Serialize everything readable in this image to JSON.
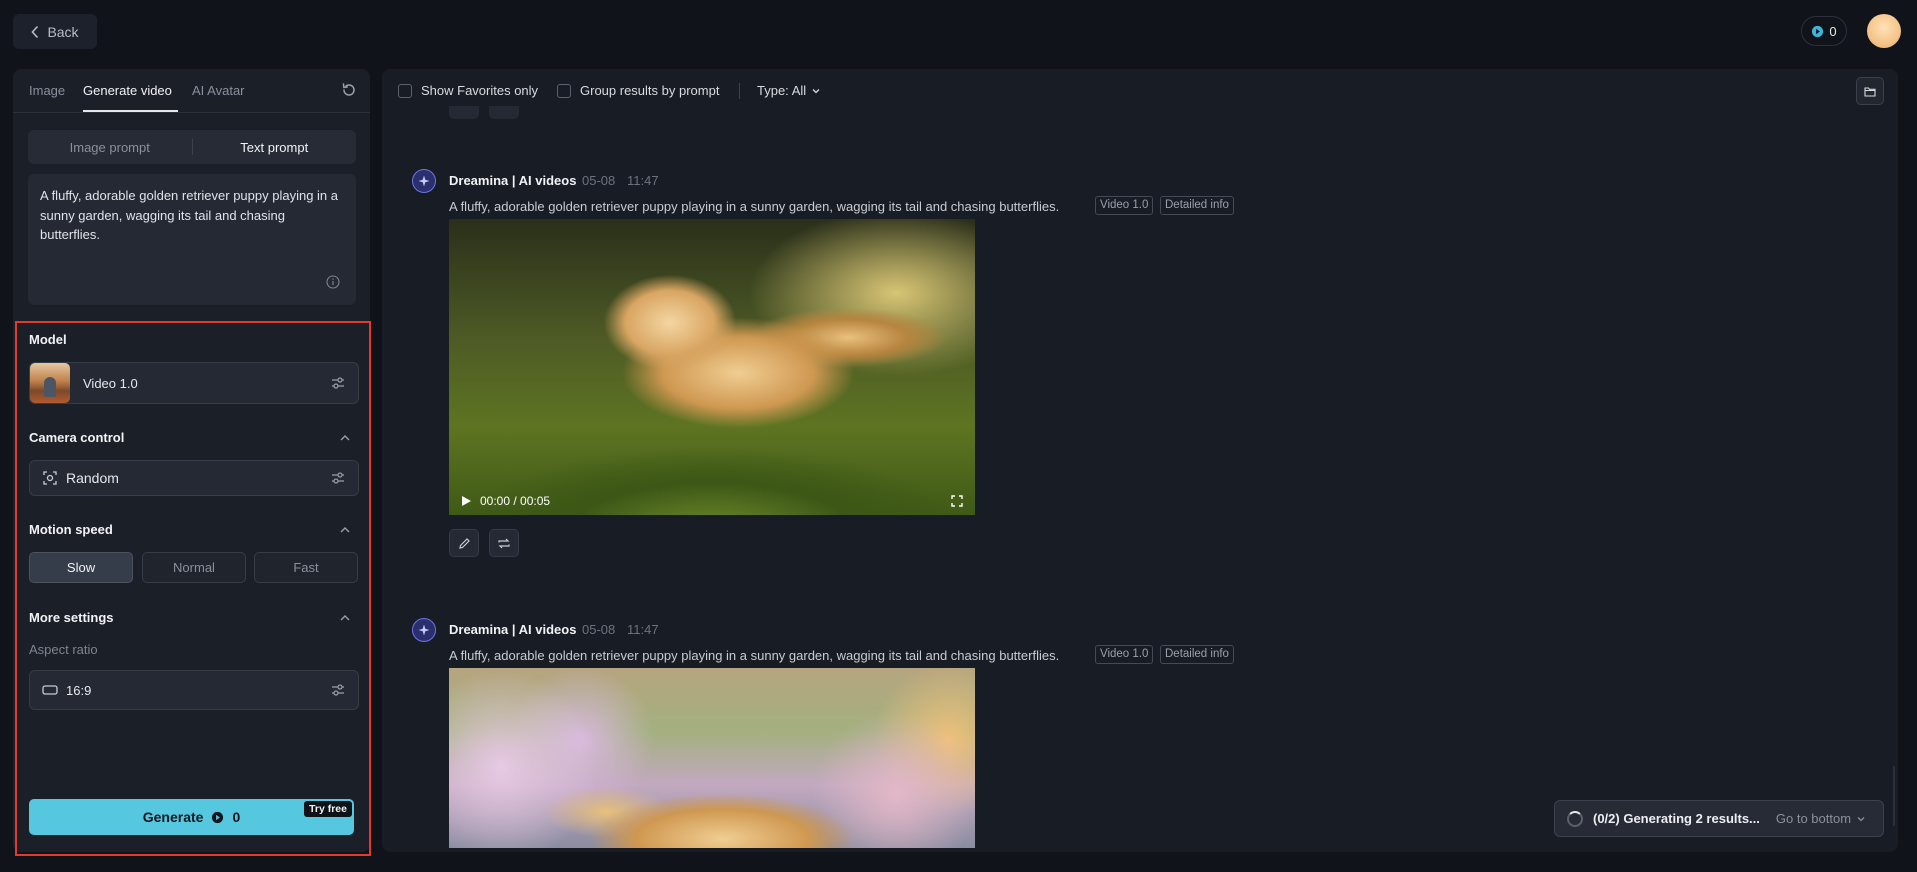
{
  "header": {
    "back_label": "Back",
    "credits": "0"
  },
  "left": {
    "tabs": [
      "Image",
      "Generate video",
      "AI Avatar"
    ],
    "active_tab": "Generate video",
    "prompt_modes": [
      "Image prompt",
      "Text prompt"
    ],
    "active_mode": "Text prompt",
    "prompt_text": "A fluffy, adorable golden retriever puppy playing in a sunny garden, wagging its tail and chasing butterflies.",
    "model": {
      "title": "Model",
      "value": "Video 1.0"
    },
    "camera": {
      "title": "Camera control",
      "value": "Random"
    },
    "motion": {
      "title": "Motion speed",
      "options": [
        "Slow",
        "Normal",
        "Fast"
      ],
      "selected": "Slow"
    },
    "more": {
      "title": "More settings",
      "aspect_label": "Aspect ratio",
      "aspect_value": "16:9"
    },
    "generate": {
      "label": "Generate",
      "cost": "0",
      "badge": "Try free"
    },
    "highlight_color": "#e23b2e",
    "accent_color": "#55c8e0"
  },
  "main": {
    "filters": {
      "favorites": "Show Favorites only",
      "group": "Group results by prompt",
      "type": "Type: All"
    },
    "results": [
      {
        "source": "Dreamina | AI videos",
        "date": "05-08",
        "time": "11:47",
        "prompt": "A fluffy, adorable golden retriever puppy playing in a sunny garden, wagging its tail and chasing butterflies.",
        "tags": [
          "Video 1.0",
          "Detailed info"
        ],
        "video_time": "00:00 / 00:05"
      },
      {
        "source": "Dreamina | AI videos",
        "date": "05-08",
        "time": "11:47",
        "prompt": "A fluffy, adorable golden retriever puppy playing in a sunny garden, wagging its tail and chasing butterflies.",
        "tags": [
          "Video 1.0",
          "Detailed info"
        ]
      }
    ],
    "status": {
      "generating": "(0/2) Generating 2 results...",
      "go_bottom": "Go to bottom"
    }
  }
}
